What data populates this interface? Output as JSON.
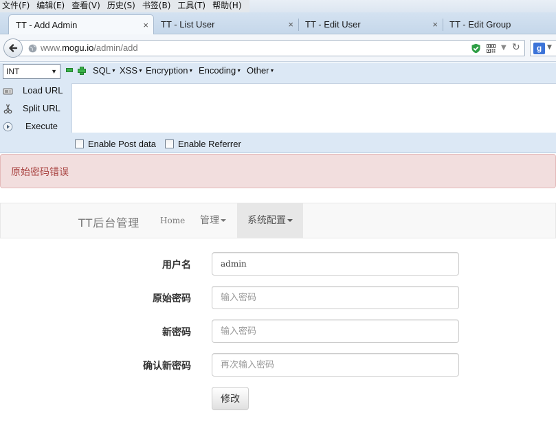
{
  "menubar": {
    "items": [
      "文件(F)",
      "编辑(E)",
      "查看(V)",
      "历史(S)",
      "书签(B)",
      "工具(T)",
      "帮助(H)"
    ]
  },
  "tabs": [
    {
      "label": "TT - Add Admin",
      "active": true
    },
    {
      "label": "TT - List User",
      "active": false
    },
    {
      "label": "TT - Edit User",
      "active": false
    },
    {
      "label": "TT - Edit Group",
      "active": false
    }
  ],
  "tab_close_glyph": "×",
  "url": {
    "prefix": "www.",
    "host": "mogu.io",
    "path": "/admin/add"
  },
  "hackbar": {
    "select_value": "INT",
    "menus": [
      "SQL",
      "XSS",
      "Encryption",
      "Encoding",
      "Other"
    ],
    "actions": [
      "Load URL",
      "Split URL",
      "Execute"
    ],
    "checkboxes": [
      "Enable Post data",
      "Enable Referrer"
    ]
  },
  "alert": {
    "message": "原始密码错误",
    "color": "#a94442"
  },
  "app_nav": {
    "brand": "TT后台管理",
    "home": "Home",
    "manage": "管理",
    "config": "系统配置"
  },
  "form": {
    "username_label": "用户名",
    "username_value": "admin",
    "old_password_label": "原始密码",
    "old_password_placeholder": "输入密码",
    "new_password_label": "新密码",
    "new_password_placeholder": "输入密码",
    "confirm_password_label": "确认新密码",
    "confirm_password_placeholder": "再次输入密码",
    "submit_label": "修改"
  },
  "icons": {
    "back": "back-arrow-icon",
    "site": "globe-icon",
    "shield": "shield-check-icon",
    "qr": "qr-code-icon",
    "reload": "reload-icon",
    "search_engine": "google-icon"
  }
}
